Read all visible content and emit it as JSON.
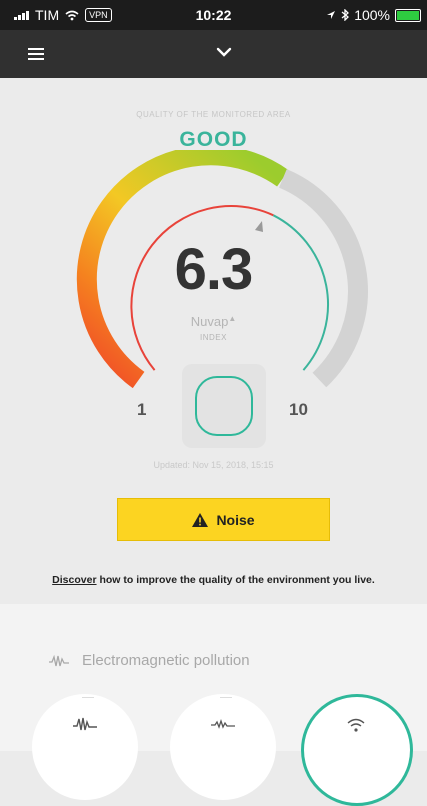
{
  "status_bar": {
    "carrier": "TIM",
    "vpn": "VPN",
    "time": "10:22",
    "battery": "100%"
  },
  "nav": {
    "menu_icon": "hamburger-icon",
    "expand_icon": "chevron-down-icon"
  },
  "air_quality": {
    "caption": "QUALITY OF THE MONITORED AREA",
    "rating": "GOOD",
    "rating_color": "#3ab49b",
    "score": "6.3",
    "score_value": 6.3,
    "brand": "Nuvap",
    "index_label": "INDEX",
    "scale_min": "1",
    "scale_max": "10",
    "updated": "Updated: Nov 15, 2018, 15:15"
  },
  "alert": {
    "label": "Noise",
    "color": "#fcd421",
    "icon": "warning-icon"
  },
  "discover": {
    "link": "Discover",
    "text": " how to improve the quality of the environment you live."
  },
  "sensors": {
    "title": "Electromagnetic pollution",
    "icon": "waveform-icon",
    "items": [
      {
        "icon": "waveform-icon"
      },
      {
        "icon": "low-frequency-wave-icon"
      },
      {
        "icon": "wifi-icon",
        "active": true
      }
    ]
  }
}
